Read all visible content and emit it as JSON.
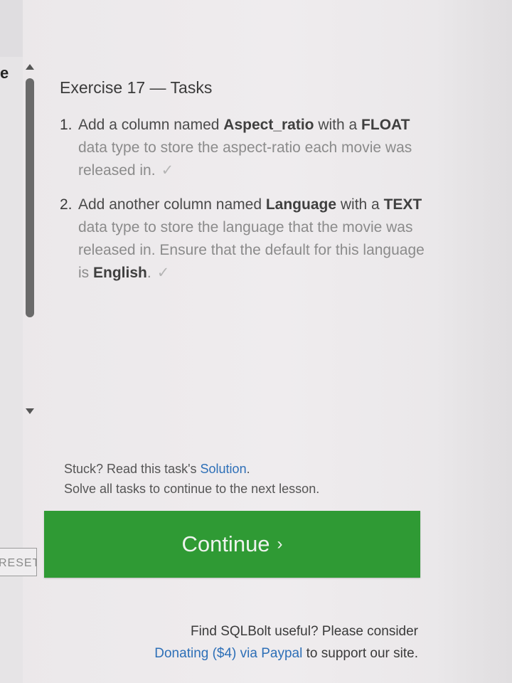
{
  "left_edge": {
    "char": "e",
    "reset_label": "RESET"
  },
  "exercise": {
    "title": "Exercise 17 — Tasks",
    "tasks": [
      {
        "number": "1.",
        "parts": {
          "p1": "Add a column named ",
          "b1": "Aspect_ratio",
          "p2": " with a ",
          "b2": "FLOAT",
          "p3": " data type to store the aspect-ratio each movie was released in."
        },
        "check": "✓"
      },
      {
        "number": "2.",
        "parts": {
          "p1": "Add another column named ",
          "b1": "Language",
          "p2": " with a ",
          "b2": "TEXT",
          "p3": " data type to store the language that the movie was released in. Ensure that the default for this language is ",
          "b3": "English",
          "p4": "."
        },
        "check": "✓"
      }
    ]
  },
  "hint": {
    "prefix": "Stuck? Read this task's ",
    "solution_link": "Solution",
    "suffix": ".",
    "line2": "Solve all tasks to continue to the next lesson."
  },
  "continue_button": {
    "label": "Continue",
    "chevron": "›"
  },
  "donate": {
    "line1": "Find SQLBolt useful? Please consider",
    "link": "Donating ($4) via Paypal",
    "suffix": " to support our site."
  },
  "colors": {
    "continue_green": "#2f9a34",
    "link_blue": "#2d6fb7"
  }
}
